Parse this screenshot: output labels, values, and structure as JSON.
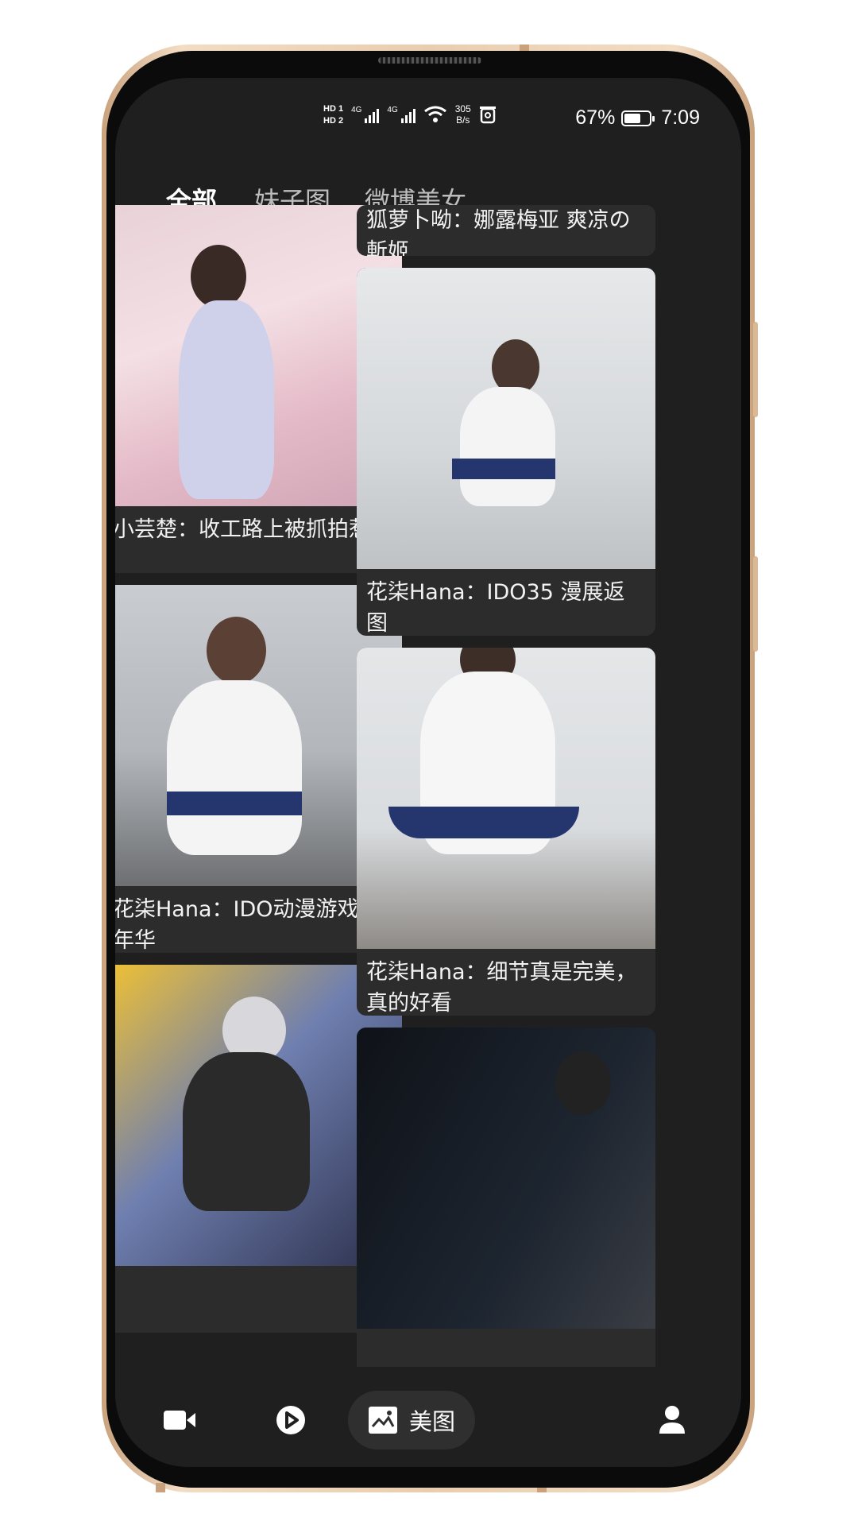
{
  "status_bar": {
    "hd1": "HD 1",
    "hd2": "HD 2",
    "sig1_label": "4G",
    "sig2_label": "4G",
    "net_speed_value": "305",
    "net_speed_unit": "B/s",
    "battery_percent": "67%",
    "battery_level": 0.67,
    "time": "7:09"
  },
  "tabs": [
    {
      "label": "全部",
      "active": true
    },
    {
      "label": "妹子图",
      "active": false
    },
    {
      "label": "微博美女",
      "active": false
    }
  ],
  "cards": [
    {
      "caption": "小芸楚：收工路上被抓拍惹"
    },
    {
      "caption": "狐萝卜呦：娜露梅亚 爽凉の斬姬"
    },
    {
      "caption": "花柒Hana：IDO35 漫展返图"
    },
    {
      "caption": "花柒Hana：IDO动漫游戏嘉年华"
    },
    {
      "caption": "花柒Hana：细节真是完美，真的好看"
    },
    {
      "caption": ""
    },
    {
      "caption": ""
    }
  ],
  "bottom_nav": {
    "items": [
      {
        "icon": "video-camera-icon",
        "label": ""
      },
      {
        "icon": "play-circle-icon",
        "label": ""
      },
      {
        "icon": "image-gallery-icon",
        "label": "美图",
        "active": true
      },
      {
        "icon": "person-icon",
        "label": ""
      }
    ]
  },
  "colors": {
    "screen_bg": "#1f1f1f",
    "card_bg": "#2c2c2c",
    "frame_gold": "#e9cdb0",
    "text_primary": "#ffffff"
  }
}
